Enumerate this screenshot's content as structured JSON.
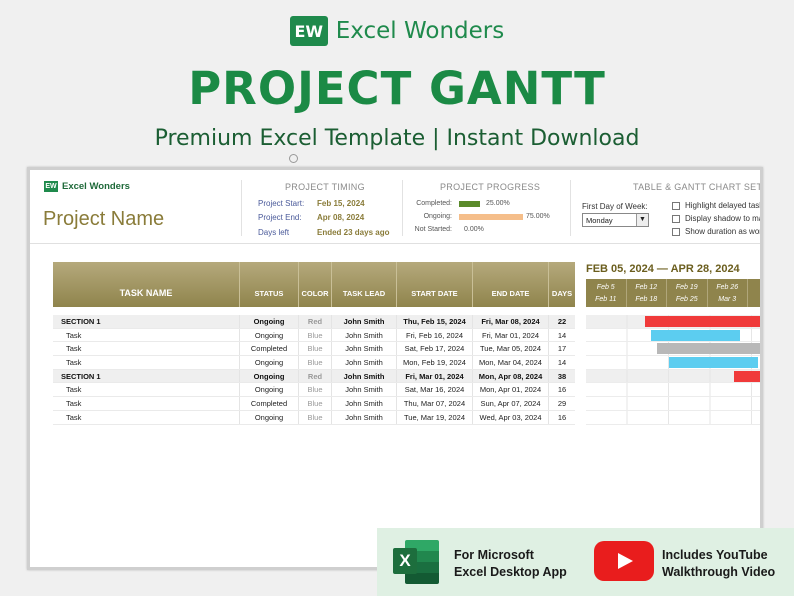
{
  "brand": {
    "logo_text": "EW",
    "name": "Excel Wonders"
  },
  "title": "PROJECT GANTT",
  "subtitle": "Premium Excel Template | Instant Download",
  "sheet": {
    "logo_name": "Excel Wonders",
    "project_name": "Project Name",
    "timing": {
      "heading": "PROJECT TIMING",
      "start_label": "Project Start:",
      "start_value": "Feb 15, 2024",
      "end_label": "Project End:",
      "end_value": "Apr 08, 2024",
      "days_label": "Days left",
      "days_value": "Ended 23 days ago"
    },
    "progress": {
      "heading": "PROJECT PROGRESS",
      "completed_label": "Completed:",
      "completed_value": "25.00%",
      "completed_fraction": 0.25,
      "ongoing_label": "Ongoing:",
      "ongoing_value": "75.00%",
      "ongoing_fraction": 0.75,
      "notstarted_label": "Not Started:",
      "notstarted_value": "0.00%",
      "notstarted_fraction": 0.0,
      "colors": {
        "completed": "#5a8a2a",
        "ongoing": "#f5be8a"
      }
    },
    "settings": {
      "heading": "TABLE & GANTT CHART SETTIN",
      "first_day_label": "First Day of Week:",
      "first_day_value": "Monday",
      "opt1": "Highlight delayed tasks",
      "opt2": "Display shadow to mark",
      "opt3": "Show duration as work"
    }
  },
  "table": {
    "headers": [
      "TASK NAME",
      "STATUS",
      "COLOR",
      "TASK LEAD",
      "START DATE",
      "END DATE",
      "DAYS"
    ],
    "rows": [
      {
        "type": "section",
        "task": "SECTION 1",
        "status": "Ongoing",
        "color": "Red",
        "lead": "John Smith",
        "start": "Thu, Feb 15, 2024",
        "end": "Fri, Mar 08, 2024",
        "days": "22"
      },
      {
        "type": "task",
        "task": "Task",
        "status": "Ongoing",
        "color": "Blue",
        "lead": "John Smith",
        "start": "Fri, Feb 16, 2024",
        "end": "Fri, Mar 01, 2024",
        "days": "14"
      },
      {
        "type": "task",
        "task": "Task",
        "status": "Completed",
        "color": "Blue",
        "lead": "John Smith",
        "start": "Sat, Feb 17, 2024",
        "end": "Tue, Mar 05, 2024",
        "days": "17"
      },
      {
        "type": "task",
        "task": "Task",
        "status": "Ongoing",
        "color": "Blue",
        "lead": "John Smith",
        "start": "Mon, Feb 19, 2024",
        "end": "Mon, Mar 04, 2024",
        "days": "14"
      },
      {
        "type": "section",
        "task": "SECTION 1",
        "status": "Ongoing",
        "color": "Red",
        "lead": "John Smith",
        "start": "Fri, Mar 01, 2024",
        "end": "Mon, Apr 08, 2024",
        "days": "38"
      },
      {
        "type": "task",
        "task": "Task",
        "status": "Ongoing",
        "color": "Blue",
        "lead": "John Smith",
        "start": "Sat, Mar 16, 2024",
        "end": "Mon, Apr 01, 2024",
        "days": "16"
      },
      {
        "type": "task",
        "task": "Task",
        "status": "Completed",
        "color": "Blue",
        "lead": "John Smith",
        "start": "Thu, Mar 07, 2024",
        "end": "Sun, Apr 07, 2024",
        "days": "29"
      },
      {
        "type": "task",
        "task": "Task",
        "status": "Ongoing",
        "color": "Blue",
        "lead": "John Smith",
        "start": "Tue, Mar 19, 2024",
        "end": "Wed, Apr 03, 2024",
        "days": "16"
      }
    ]
  },
  "gantt": {
    "range_title": "FEB 05, 2024 — APR 28, 2024",
    "weeks": [
      {
        "a": "Feb 5",
        "b": "Feb 11"
      },
      {
        "a": "Feb 12",
        "b": "Feb 18"
      },
      {
        "a": "Feb 19",
        "b": "Feb 25"
      },
      {
        "a": "Feb 26",
        "b": "Mar 3"
      }
    ],
    "bar_colors": {
      "section": "#f03a3a",
      "ongoing": "#5ccdf0",
      "completed": "#b8b8b8"
    }
  },
  "badges": {
    "excel_letter": "X",
    "excel_line1": "For Microsoft",
    "excel_line2": "Excel Desktop App",
    "youtube_line1": "Includes YouTube",
    "youtube_line2": "Walkthrough Video"
  }
}
